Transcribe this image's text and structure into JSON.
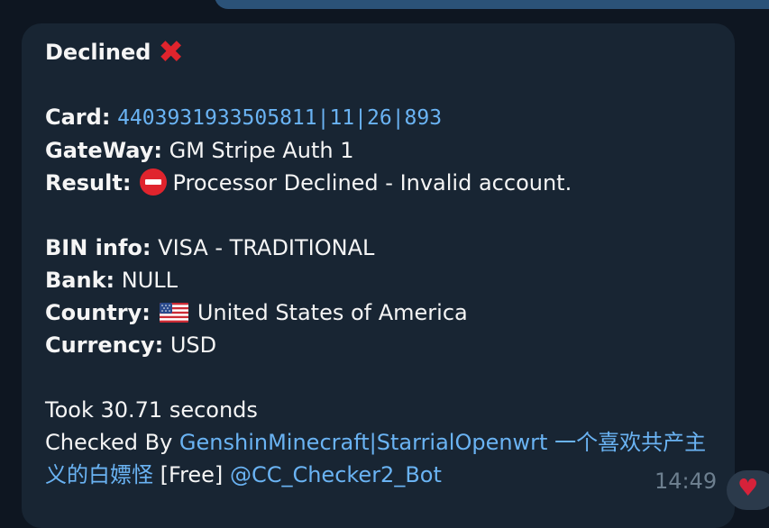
{
  "message": {
    "title": "Declined",
    "title_icon": "cross-mark-icon",
    "card_label": "Card:",
    "card_value": "4403931933505811|11|26|893",
    "gateway_label": "GateWay:",
    "gateway_value": "GM Stripe Auth 1",
    "result_label": "Result:",
    "result_icon": "no-entry-icon",
    "result_value": "Processor Declined - Invalid account.",
    "bin_label": "BIN info:",
    "bin_value": "VISA - TRADITIONAL",
    "bank_label": "Bank:",
    "bank_value": "NULL",
    "country_label": "Country:",
    "country_icon": "us-flag-icon",
    "country_value": "United States of America",
    "currency_label": "Currency:",
    "currency_value": "USD",
    "took": "Took 30.71 seconds",
    "checked_by_label": "Checked By",
    "checked_by_link": "GenshinMinecraft|StarrialOpenwrt 一个喜欢共产主义的白嫖怪",
    "free_tag": "[Free]",
    "bot_handle": "@CC_Checker2_Bot",
    "time": "14:49"
  },
  "reaction": {
    "icon": "heart-icon",
    "color": "#d6223a"
  },
  "colors": {
    "background": "#0e1621",
    "bubble": "#182533",
    "link": "#6ab3f3",
    "accent_red": "#e0242d"
  }
}
